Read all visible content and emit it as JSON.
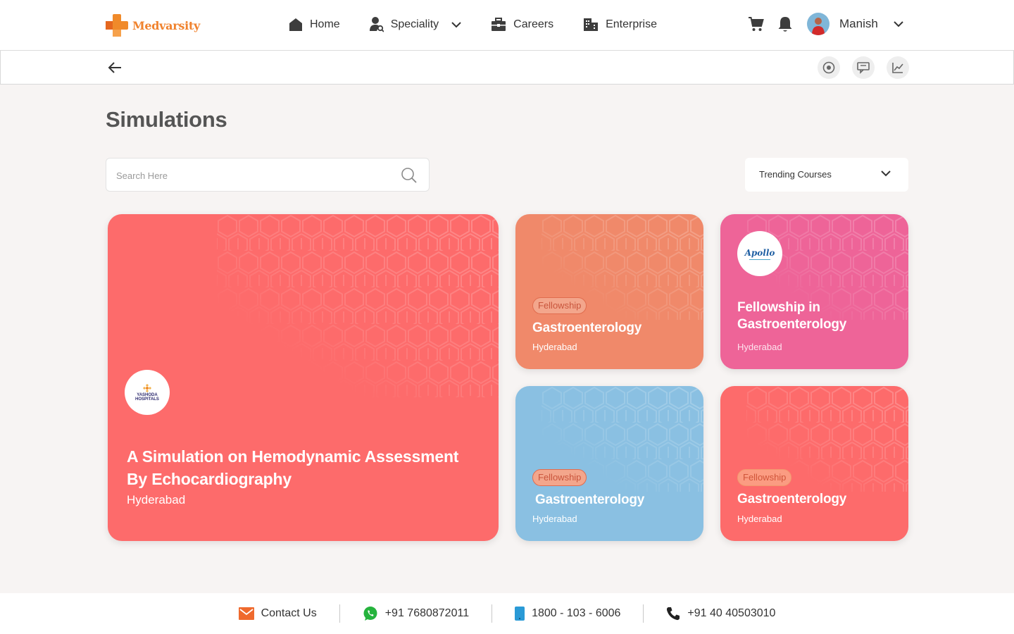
{
  "brand": {
    "name": "Medvarsity",
    "accent": "#f0822d"
  },
  "nav": {
    "items": [
      {
        "label": "Home",
        "icon": "home-icon"
      },
      {
        "label": "Speciality",
        "icon": "speciality-icon"
      },
      {
        "label": "Careers",
        "icon": "briefcase-icon"
      },
      {
        "label": "Enterprise",
        "icon": "building-icon"
      }
    ]
  },
  "user": {
    "name": "Manish"
  },
  "page": {
    "title": "Simulations",
    "search": {
      "placeholder": "Search Here",
      "value": ""
    },
    "filter": {
      "selected": "Trending Courses"
    }
  },
  "cards": {
    "featured": {
      "title": "A Simulation on Hemodynamic Assessment By Echocardiography",
      "location": "Hyderabad",
      "color": "#fd6b6b",
      "logo_text": "YASHODA HOSPITALS"
    },
    "c1": {
      "badge": "Fellowship",
      "title": "Gastroenterology",
      "location": "Hyderabad",
      "color": "#f0896a"
    },
    "c2": {
      "title": "Fellowship in Gastroenterology",
      "location": "Hyderabad",
      "color": "#ee6498",
      "logo_text": "Apollo"
    },
    "c3": {
      "badge": "Fellowship",
      "title": "Gastroenterology",
      "location": "Hyderabad",
      "color": "#8ac0e2"
    },
    "c4": {
      "badge": "Fellowship",
      "title": "Gastroenterology",
      "location": "Hyderabad",
      "color": "#fd6b6b"
    }
  },
  "footer": {
    "contact": "Contact Us",
    "whatsapp": "+91 7680872011",
    "tollfree": "1800 - 103 - 6006",
    "phone": "+91 40 40503010"
  }
}
